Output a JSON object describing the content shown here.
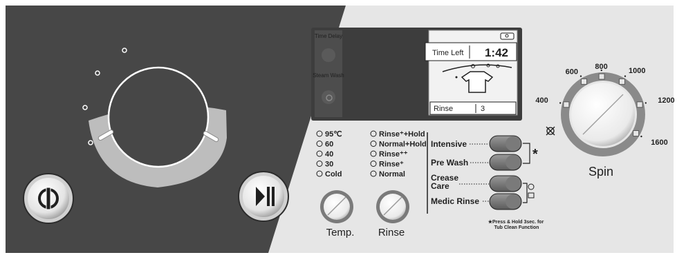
{
  "colors": {
    "dark_panel": "#474747",
    "light_panel": "#e6e6e6",
    "ring": "#bdbdbd",
    "accent_gray": "#8a8a8a",
    "text": "#1f1f1f",
    "display_bg": "#3d3d3d"
  },
  "display": {
    "time_delay_label": "Time Delay",
    "steam_wash_label": "Steam Wash",
    "time_left_label": "Time Left",
    "time_left_value": "1:42",
    "stage_label": "Rinse",
    "stage_value": "3",
    "lock_icon": "child-lock-icon",
    "shirt_icon": "shirt-icon"
  },
  "temperature": {
    "options": [
      "95℃",
      "60",
      "40",
      "30",
      "Cold"
    ],
    "knob_label": "Temp."
  },
  "rinse": {
    "options": [
      "Rinse⁺+Hold",
      "Normal+Hold",
      "Rinse⁺⁺",
      "Rinse⁺",
      "Normal"
    ],
    "knob_label": "Rinse"
  },
  "options_buttons": {
    "items": [
      "Intensive",
      "Pre Wash",
      "Crease Care",
      "Medic Rinse"
    ],
    "star_mark": "*",
    "note_line1": "★Press & Hold 3sec. for",
    "note_line2": "Tub Clean Function"
  },
  "spin": {
    "label": "Spin",
    "speeds": [
      "400",
      "600",
      "800",
      "1000",
      "1200",
      "1600"
    ],
    "no_spin_icon": "no-spin-icon"
  },
  "buttons": {
    "power_icon": "power-icon",
    "start_pause_icon": "play-pause-icon"
  }
}
